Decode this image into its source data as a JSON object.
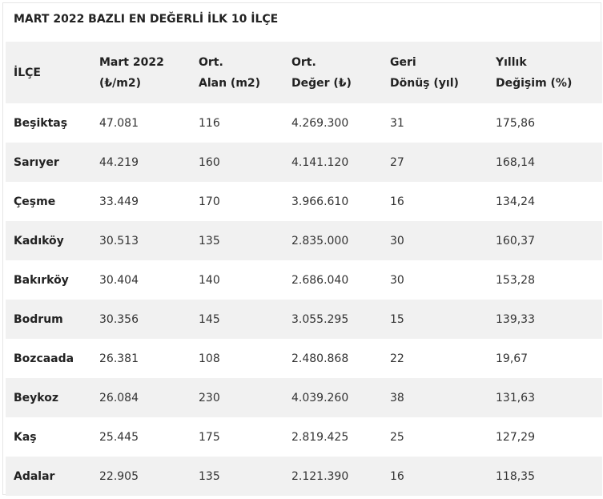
{
  "title": "MART 2022 BAZLI EN DEĞERLİ İLK 10 İLÇE",
  "headers": [
    [
      "İLÇE"
    ],
    [
      "Mart 2022",
      "(₺/m2)"
    ],
    [
      "Ort.",
      "Alan (m2)"
    ],
    [
      "Ort.",
      "Değer (₺)"
    ],
    [
      "Geri",
      "Dönüş (yıl)"
    ],
    [
      "Yıllık",
      "Değişim (%)"
    ]
  ],
  "rows": [
    [
      "Beşiktaş",
      "47.081",
      "116",
      "4.269.300",
      "31",
      "175,86"
    ],
    [
      "Sarıyer",
      "44.219",
      "160",
      "4.141.120",
      "27",
      "168,14"
    ],
    [
      "Çeşme",
      "33.449",
      "170",
      "3.966.610",
      "16",
      "134,24"
    ],
    [
      "Kadıköy",
      "30.513",
      "135",
      "2.835.000",
      "30",
      "160,37"
    ],
    [
      "Bakırköy",
      "30.404",
      "140",
      "2.686.040",
      "30",
      "153,28"
    ],
    [
      "Bodrum",
      "30.356",
      "145",
      "3.055.295",
      "15",
      "139,33"
    ],
    [
      "Bozcaada",
      "26.381",
      "108",
      "2.480.868",
      "22",
      "19,67"
    ],
    [
      "Beykoz",
      "26.084",
      "230",
      "4.039.260",
      "38",
      "131,63"
    ],
    [
      "Kaş",
      "25.445",
      "175",
      "2.819.425",
      "25",
      "127,29"
    ],
    [
      "Adalar",
      "22.905",
      "135",
      "2.121.390",
      "16",
      "118,35"
    ]
  ]
}
